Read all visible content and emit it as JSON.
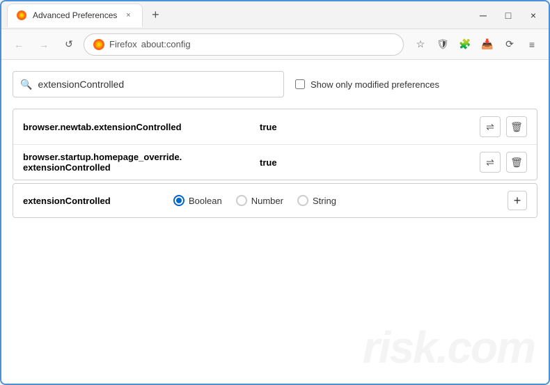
{
  "window": {
    "title": "Advanced Preferences",
    "close_label": "×",
    "minimize_label": "─",
    "maximize_label": "□"
  },
  "tab": {
    "label": "Advanced Preferences",
    "new_tab_label": "+"
  },
  "nav": {
    "back_label": "←",
    "forward_label": "→",
    "refresh_label": "↺",
    "browser_name": "Firefox",
    "url": "about:config",
    "bookmark_icon": "☆",
    "shield_icon": "🛡",
    "extension_icon": "🧩",
    "download_icon": "📥",
    "sync_icon": "⟳",
    "menu_icon": "≡"
  },
  "search": {
    "placeholder": "extensionControlled",
    "current_value": "extensionControlled",
    "show_modified_label": "Show only modified preferences"
  },
  "preferences": [
    {
      "name": "browser.newtab.extensionControlled",
      "value": "true"
    },
    {
      "name": "browser.startup.homepage_override.\nextensionControlled",
      "name_line1": "browser.startup.homepage_override.",
      "name_line2": "extensionControlled",
      "value": "true",
      "multiline": true
    }
  ],
  "new_pref": {
    "name": "extensionControlled",
    "types": [
      {
        "id": "boolean",
        "label": "Boolean",
        "selected": true
      },
      {
        "id": "number",
        "label": "Number",
        "selected": false
      },
      {
        "id": "string",
        "label": "String",
        "selected": false
      }
    ],
    "add_label": "+"
  },
  "watermark": {
    "text": "risk.com"
  }
}
